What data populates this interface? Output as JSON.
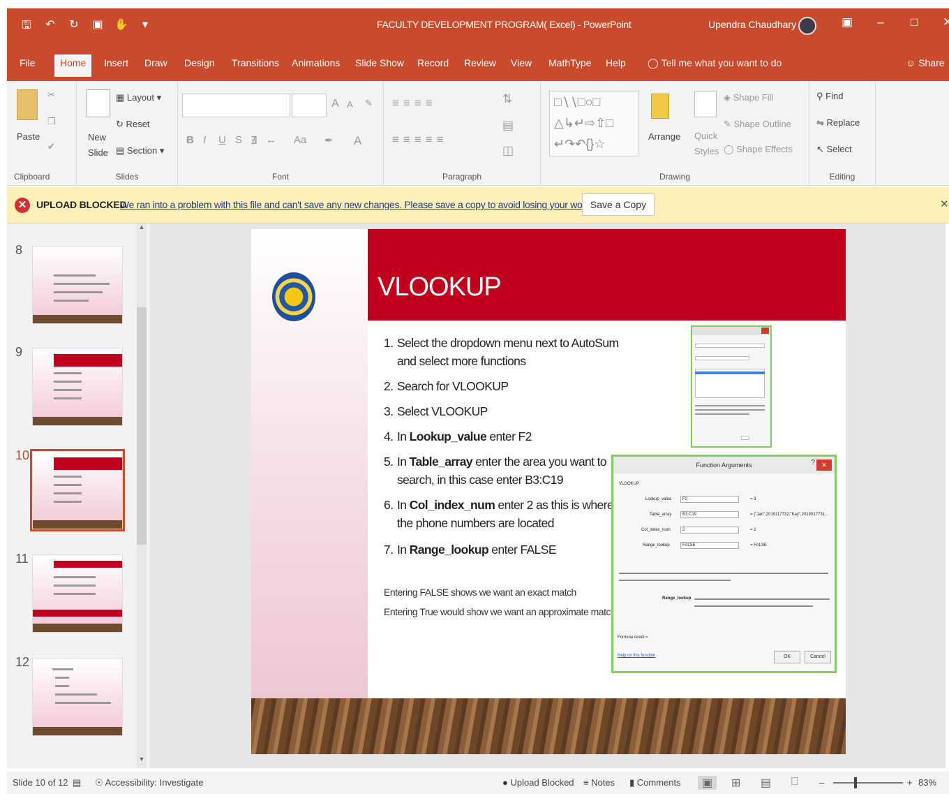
{
  "window": {
    "title": "FACULTY DEVELOPMENT PROGRAM( Excel) - PowerPoint",
    "user": "Upendra Chaudhary",
    "qat": [
      "save-icon",
      "undo-icon",
      "redo-icon",
      "present-icon",
      "touch-icon",
      "customize-icon"
    ]
  },
  "tabs": [
    "File",
    "Home",
    "Insert",
    "Draw",
    "Design",
    "Transitions",
    "Animations",
    "Slide Show",
    "Record",
    "Review",
    "View",
    "MathType",
    "Help"
  ],
  "tellme": "Tell me what you want to do",
  "share": "Share",
  "ribbon": {
    "clipboard": {
      "paste": "Paste",
      "label": "Clipboard"
    },
    "slides": {
      "new_slide": "New\nSlide",
      "layout": "Layout",
      "reset": "Reset",
      "section": "Section",
      "label": "Slides"
    },
    "font": {
      "label": "Font",
      "bold": "B",
      "italic": "I",
      "underline": "U",
      "shadow": "S",
      "font_color": "A",
      "change_case": "Aa",
      "grow": "A",
      "shrink": "A"
    },
    "paragraph": {
      "label": "Paragraph"
    },
    "drawing": {
      "arrange": "Arrange",
      "quick_styles": "Quick\nStyles",
      "shape_fill": "Shape Fill",
      "shape_outline": "Shape Outline",
      "shape_effects": "Shape Effects",
      "label": "Drawing"
    },
    "editing": {
      "find": "Find",
      "replace": "Replace",
      "select": "Select",
      "label": "Editing"
    }
  },
  "infobar": {
    "title": "UPLOAD BLOCKED",
    "message": "We ran into a problem with this file and can't save any new changes. Please save a copy to avoid losing your work.",
    "button": "Save a Copy"
  },
  "thumbnails": [
    {
      "num": "8"
    },
    {
      "num": "9"
    },
    {
      "num": "10"
    },
    {
      "num": "11"
    },
    {
      "num": "12"
    }
  ],
  "slide": {
    "title": "VLOOKUP",
    "steps": [
      {
        "n": "1.",
        "text": "Select the dropdown menu next to AutoSum and select more functions"
      },
      {
        "n": "2.",
        "text": "Search for VLOOKUP"
      },
      {
        "n": "3.",
        "text": "Select VLOOKUP"
      },
      {
        "n": "4.",
        "pre": "In ",
        "bold": "Lookup_value",
        "post": " enter F2"
      },
      {
        "n": "5.",
        "pre": "In ",
        "bold": "Table_array",
        "post": " enter the area you want to search, in this case enter B3:C19"
      },
      {
        "n": "6.",
        "pre": "In ",
        "bold": "Col_index_num",
        "post": " enter 2 as this is where the phone numbers are located"
      },
      {
        "n": "7.",
        "pre": "In ",
        "bold": "Range_lookup",
        "post": " enter FALSE"
      }
    ],
    "notes": [
      "Entering FALSE shows we want an exact match",
      "Entering True would show we want an approximate match"
    ],
    "dialog": {
      "title": "Function Arguments",
      "function": "VLOOKUP",
      "rows": [
        {
          "label": "Lookup_value",
          "value": "F2",
          "result": "= 3"
        },
        {
          "label": "Table_array",
          "value": "B3:C19",
          "result": "= {\"Jan\",2019117732;\"Kay\",2019017731..."
        },
        {
          "label": "Col_index_num",
          "value": "2",
          "result": "= 2"
        },
        {
          "label": "Range_lookup",
          "value": "FALSE",
          "result": "= FALSE"
        }
      ],
      "range_lookup_label": "Range_lookup",
      "formula_result": "Formula result =",
      "help": "Help on this function",
      "ok": "OK",
      "cancel": "Cancel"
    }
  },
  "status": {
    "slide": "Slide 10 of 12",
    "accessibility": "Accessibility: Investigate",
    "upload": "Upload Blocked",
    "notes": "Notes",
    "comments": "Comments",
    "zoom": "83%"
  }
}
